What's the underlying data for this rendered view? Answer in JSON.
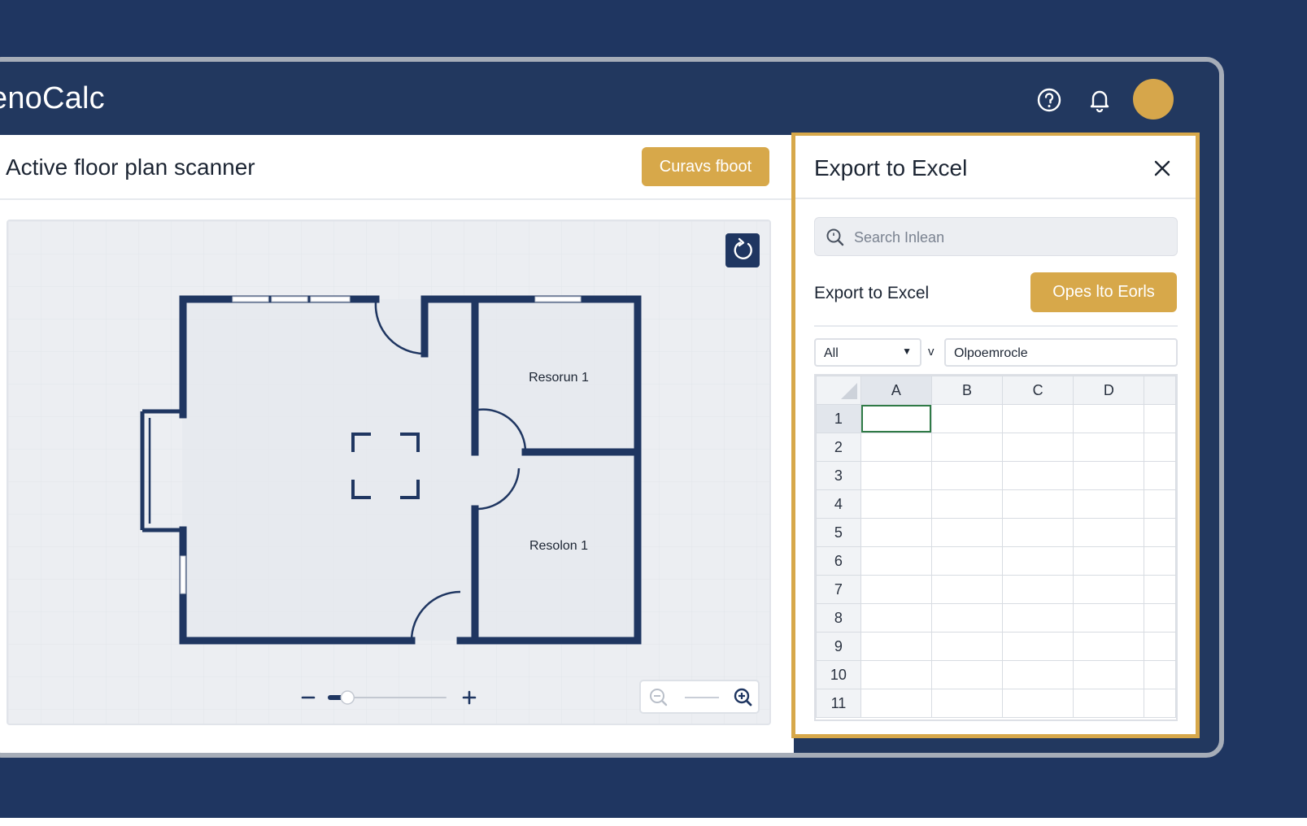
{
  "app": {
    "title": "enoCalc"
  },
  "header": {
    "help_icon": "help-circle-icon",
    "bell_icon": "bell-icon",
    "avatar_color": "#d6a64b"
  },
  "scanner": {
    "title": "Active floor plan scanner",
    "action_label": "Curavs fboot",
    "rooms": [
      "Resorun 1",
      "Resolon 1"
    ]
  },
  "export": {
    "title": "Export to Excel",
    "search_placeholder": "Search Inlean",
    "label": "Export to Excel",
    "open_label": "Opes lto Eorls",
    "filter_value": "All",
    "separator": "v",
    "formula_value": "Olpoemrocle",
    "columns": [
      "A",
      "B",
      "C",
      "D"
    ],
    "rows": [
      "1",
      "2",
      "3",
      "4",
      "5",
      "6",
      "7",
      "8",
      "9",
      "10",
      "11"
    ]
  },
  "zoom": {
    "level": 0.15
  },
  "colors": {
    "navy": "#1f3661",
    "gold": "#d7a84a",
    "selection": "#2f7a46"
  }
}
